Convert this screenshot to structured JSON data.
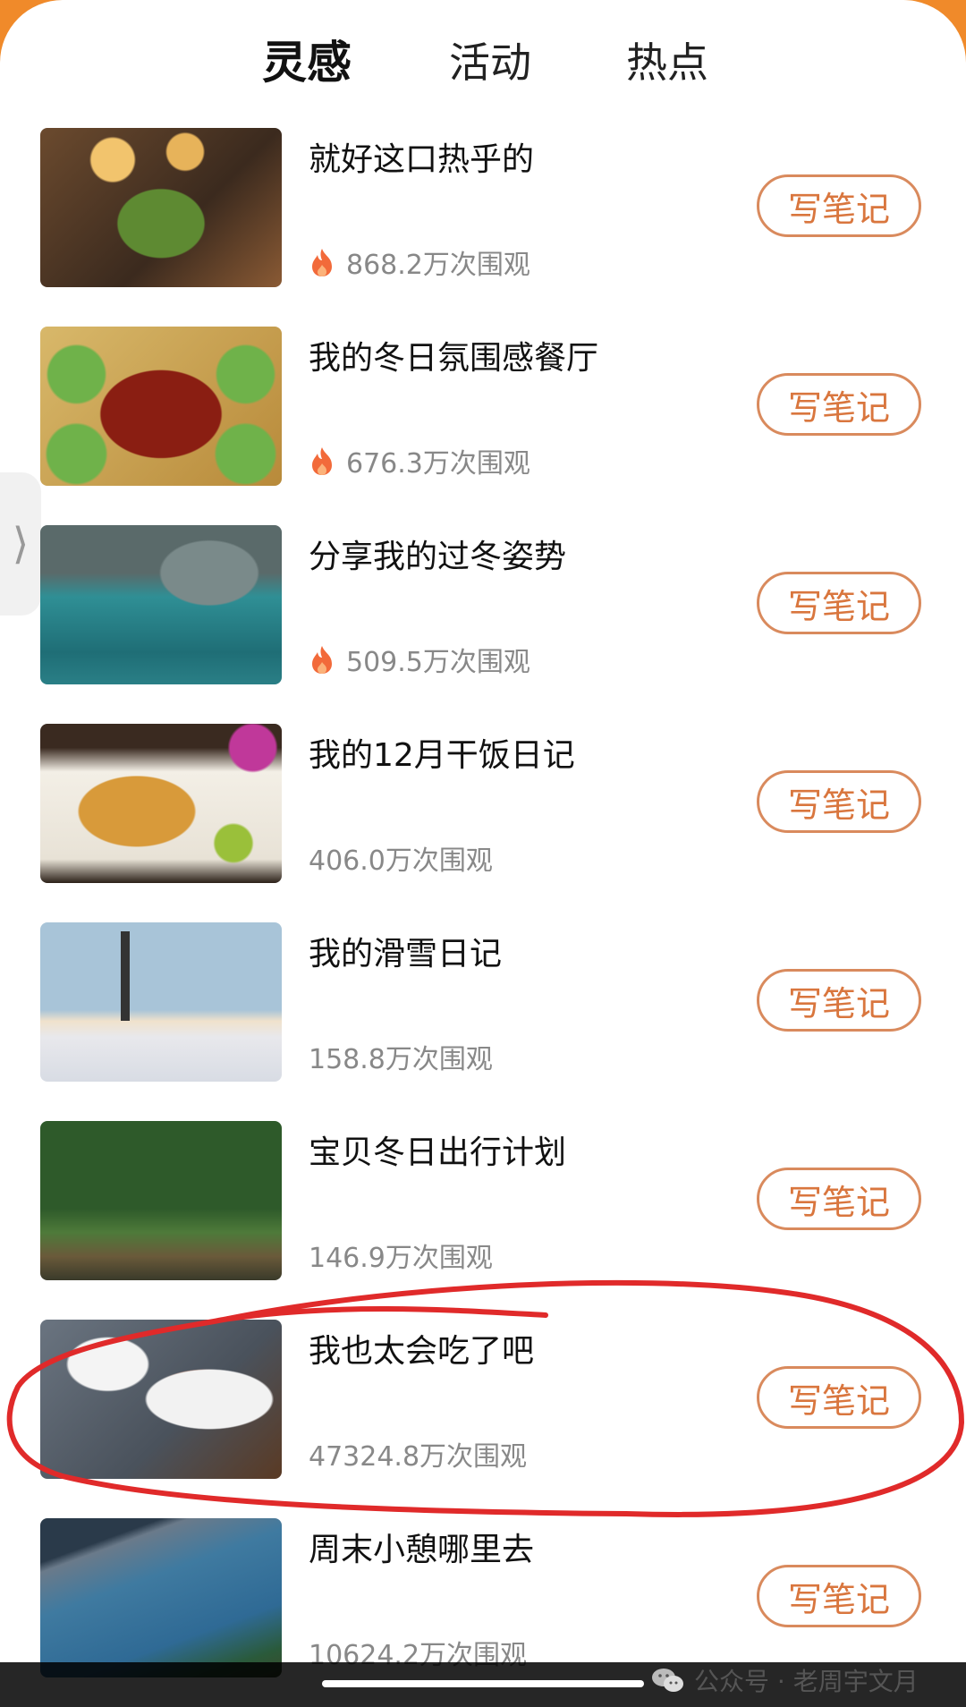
{
  "tabs": [
    {
      "label": "灵感",
      "active": true
    },
    {
      "label": "活动",
      "active": false
    },
    {
      "label": "热点",
      "active": false
    }
  ],
  "side_handle": {
    "glyph": "⟩"
  },
  "items": [
    {
      "title": "就好这口热乎的",
      "views": "868.2万次围观",
      "hot": true,
      "button": "写笔记",
      "image": "food-stew-thumbnail"
    },
    {
      "title": "我的冬日氛围感餐厅",
      "views": "676.3万次围观",
      "hot": true,
      "button": "写笔记",
      "image": "chicken-dish-thumbnail"
    },
    {
      "title": "分享我的过冬姿势",
      "views": "509.5万次围观",
      "hot": true,
      "button": "写笔记",
      "image": "hot-spring-thumbnail"
    },
    {
      "title": "我的12月干饭日记",
      "views": "406.0万次围观",
      "hot": false,
      "button": "写笔记",
      "image": "fried-chicken-thumbnail"
    },
    {
      "title": "我的滑雪日记",
      "views": "158.8万次围观",
      "hot": false,
      "button": "写笔记",
      "image": "ski-slope-thumbnail"
    },
    {
      "title": "宝贝冬日出行计划",
      "views": "146.9万次围观",
      "hot": false,
      "button": "写笔记",
      "image": "forest-walk-thumbnail"
    },
    {
      "title": "我也太会吃了吧",
      "views": "47324.8万次围观",
      "hot": false,
      "button": "写笔记",
      "image": "rice-meal-thumbnail"
    },
    {
      "title": "周末小憩哪里去",
      "views": "10624.2万次围观",
      "hot": false,
      "button": "写笔记",
      "image": "coastline-thumbnail"
    }
  ],
  "watermark": {
    "text": "公众号 · 老周宇文月"
  },
  "colors": {
    "accent": "#d9763e",
    "fire": "#f26a3a",
    "annotation": "#e02a2a"
  }
}
